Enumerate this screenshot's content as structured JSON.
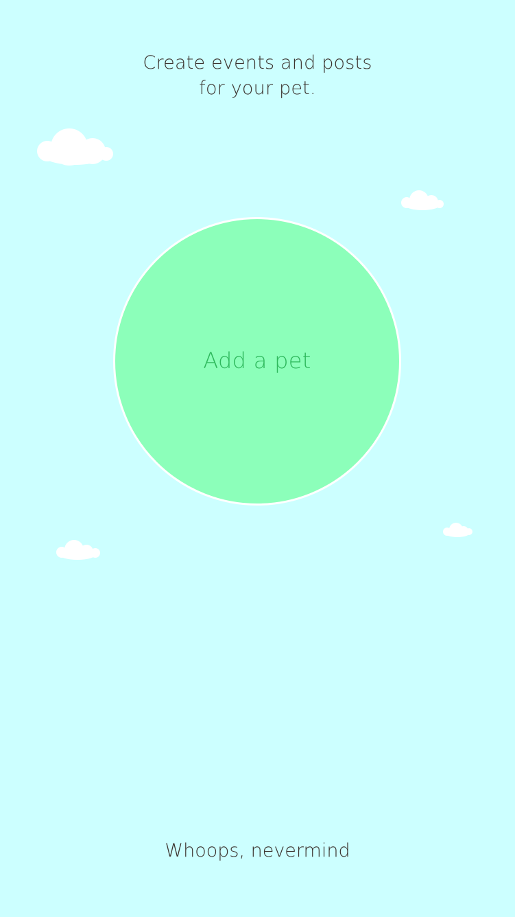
{
  "colors": {
    "background": "#ccffff",
    "circle_fill": "#8cffba",
    "circle_border": "#ffffff",
    "circle_text": "#2eb85c",
    "text": "#3b332e",
    "cloud": "#ffffff"
  },
  "header": {
    "line1": "Create  events and posts",
    "line2": "for your pet."
  },
  "add_pet": {
    "label": "Add a pet"
  },
  "footer": {
    "dismiss_label": "Whoops, nevermind"
  },
  "decorations": {
    "cloud_icon": "cloud-icon"
  }
}
